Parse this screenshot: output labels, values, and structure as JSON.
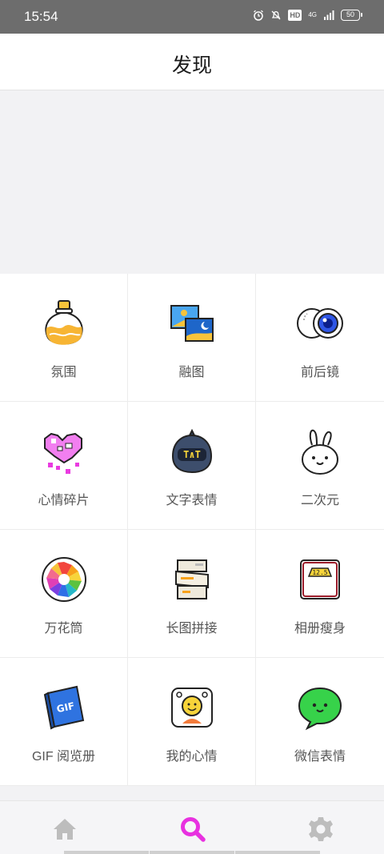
{
  "status_bar": {
    "time": "15:54",
    "hd": "HD",
    "network": "4G",
    "battery": "50"
  },
  "header": {
    "title": "发现"
  },
  "tools": [
    {
      "label": "氛围",
      "icon": "perfume-bottle-icon"
    },
    {
      "label": "融图",
      "icon": "blend-images-icon"
    },
    {
      "label": "前后镜",
      "icon": "front-back-camera-icon"
    },
    {
      "label": "心情碎片",
      "icon": "pixel-heart-icon"
    },
    {
      "label": "文字表情",
      "icon": "text-emoji-face-icon"
    },
    {
      "label": "二次元",
      "icon": "bunny-character-icon"
    },
    {
      "label": "万花筒",
      "icon": "kaleidoscope-icon"
    },
    {
      "label": "长图拼接",
      "icon": "long-image-stitch-icon"
    },
    {
      "label": "相册瘦身",
      "icon": "scale-icon"
    },
    {
      "label": "GIF 阅览册",
      "icon": "gif-book-icon"
    },
    {
      "label": "我的心情",
      "icon": "smiley-frame-icon"
    },
    {
      "label": "微信表情",
      "icon": "chat-bubble-face-icon"
    }
  ],
  "bottom_nav": [
    {
      "icon": "home-icon",
      "active": false
    },
    {
      "icon": "search-icon",
      "active": true
    },
    {
      "icon": "gear-icon",
      "active": false
    }
  ],
  "colors": {
    "accent": "#e831e0",
    "inactive": "#bdbdbd",
    "status_bar": "#6d6d6d"
  }
}
